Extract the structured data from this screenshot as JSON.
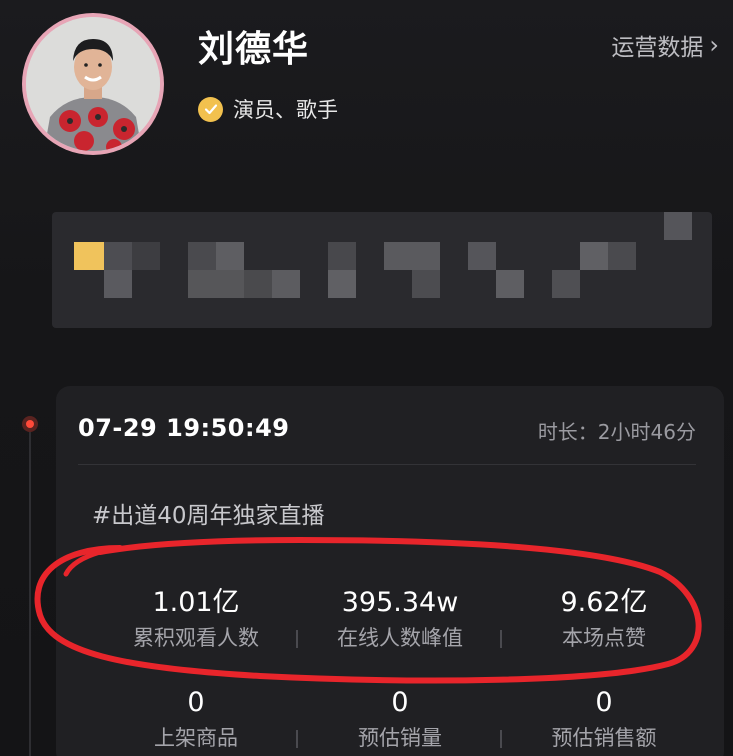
{
  "profile": {
    "name": "刘德华",
    "verified_label": "演员、歌手",
    "ops_link_label": "运营数据",
    "ops_link_chevron": "›"
  },
  "live": {
    "date_time": "07-29 19:50:49",
    "duration": "时长：2小时46分",
    "topic_tag": "#出道40周年独家直播",
    "stats_primary": [
      {
        "value": "1.01亿",
        "label": "累积观看人数"
      },
      {
        "value": "395.34w",
        "label": "在线人数峰值"
      },
      {
        "value": "9.62亿",
        "label": "本场点赞"
      }
    ],
    "stats_secondary": [
      {
        "value": "0",
        "label": "上架商品"
      },
      {
        "value": "0",
        "label": "预估销量"
      },
      {
        "value": "0",
        "label": "预估销售额"
      }
    ]
  },
  "colors": {
    "verify_badge": "#f2c14e",
    "annotation_circle": "#e8252b",
    "timeline_dot": "#ff4a3a"
  },
  "icons": {
    "verify": "check-badge-icon",
    "chevron": "chevron-right-icon",
    "timeline": "live-dot-icon"
  }
}
